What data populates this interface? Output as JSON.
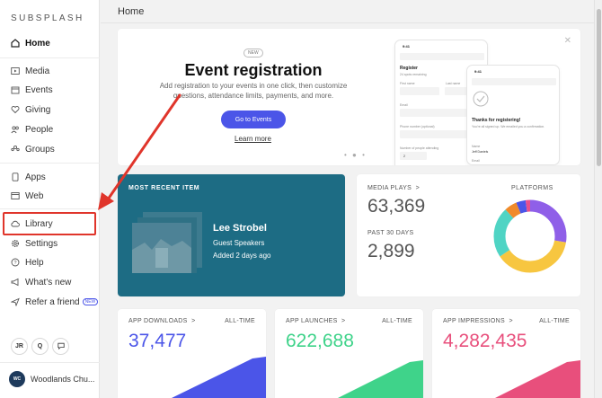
{
  "brand": "SUBSPLASH",
  "breadcrumb": "Home",
  "sidebar": {
    "items": [
      {
        "label": "Home",
        "icon": "home-icon"
      },
      {
        "label": "Media",
        "icon": "media-icon"
      },
      {
        "label": "Events",
        "icon": "calendar-icon"
      },
      {
        "label": "Giving",
        "icon": "heart-icon"
      },
      {
        "label": "People",
        "icon": "people-icon"
      },
      {
        "label": "Groups",
        "icon": "groups-icon"
      },
      {
        "label": "Apps",
        "icon": "apps-icon"
      },
      {
        "label": "Web",
        "icon": "web-icon"
      },
      {
        "label": "Library",
        "icon": "cloud-icon"
      },
      {
        "label": "Settings",
        "icon": "gear-icon"
      },
      {
        "label": "Help",
        "icon": "help-icon"
      },
      {
        "label": "What's new",
        "icon": "megaphone-icon"
      },
      {
        "label": "Refer a friend",
        "icon": "refer-icon"
      }
    ],
    "refer_badge": "NEW",
    "user_initials": "JR",
    "search_glyph": "Q",
    "org_name": "Woodlands Chu...",
    "org_logo_text": "WC"
  },
  "promo": {
    "badge": "NEW",
    "title": "Event registration",
    "description": "Add registration to your events in one click, then customize questions, attendance limits, payments, and more.",
    "button": "Go to Events",
    "link": "Learn more",
    "phone1": {
      "time": "9:41",
      "title": "Register",
      "spots": "24 spots remaining",
      "first_name": "First name",
      "last_name": "Last name",
      "email": "Email",
      "phone": "Phone number (optional)",
      "attending": "Number of people attending",
      "count": "2"
    },
    "phone2": {
      "time": "9:41",
      "thanks": "Thanks for registering!",
      "emailed": "You're all signed up. We emailed you a confirmation.",
      "name_label": "Name",
      "name": "Jeff Daniels",
      "email_label": "Email"
    }
  },
  "recent": {
    "label": "MOST RECENT ITEM",
    "title": "Lee Strobel",
    "subtitle": "Guest Speakers",
    "added": "Added 2 days ago"
  },
  "media": {
    "plays_label": "MEDIA PLAYS",
    "plays_value": "63,369",
    "past_label": "PAST 30 DAYS",
    "past_value": "2,899",
    "platforms_label": "PLATFORMS",
    "platform_colors": [
      "#8f5fe8",
      "#f7c640",
      "#4fd4c4",
      "#f08a2a",
      "#4b55e8",
      "#e84f8c"
    ]
  },
  "bottom_cards": [
    {
      "label": "APP DOWNLOADS",
      "range": "ALL-TIME",
      "value": "37,477",
      "color": "#4b55e8"
    },
    {
      "label": "APP LAUNCHES",
      "range": "ALL-TIME",
      "value": "622,688",
      "color": "#3fd38a"
    },
    {
      "label": "APP IMPRESSIONS",
      "range": "ALL-TIME",
      "value": "4,282,435",
      "color": "#e84f7c"
    }
  ]
}
